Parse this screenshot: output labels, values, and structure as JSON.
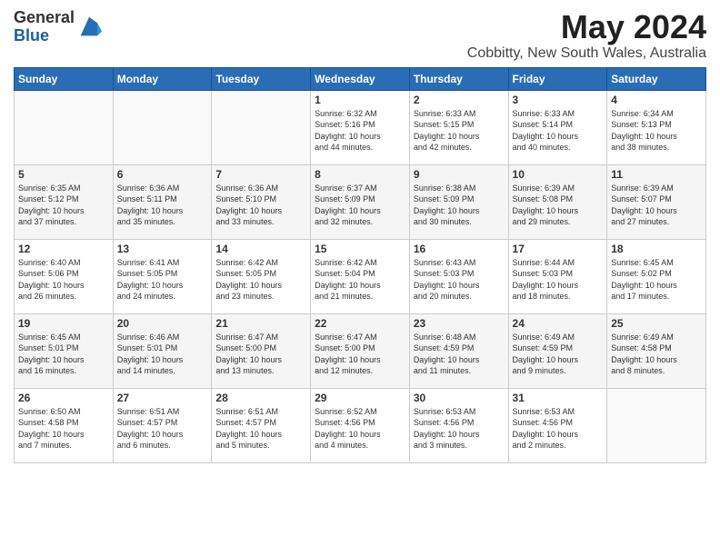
{
  "header": {
    "logo_general": "General",
    "logo_blue": "Blue",
    "month_title": "May 2024",
    "location": "Cobbitty, New South Wales, Australia"
  },
  "days_of_week": [
    "Sunday",
    "Monday",
    "Tuesday",
    "Wednesday",
    "Thursday",
    "Friday",
    "Saturday"
  ],
  "weeks": [
    {
      "days": [
        {
          "num": "",
          "info": ""
        },
        {
          "num": "",
          "info": ""
        },
        {
          "num": "",
          "info": ""
        },
        {
          "num": "1",
          "info": "Sunrise: 6:32 AM\nSunset: 5:16 PM\nDaylight: 10 hours\nand 44 minutes."
        },
        {
          "num": "2",
          "info": "Sunrise: 6:33 AM\nSunset: 5:15 PM\nDaylight: 10 hours\nand 42 minutes."
        },
        {
          "num": "3",
          "info": "Sunrise: 6:33 AM\nSunset: 5:14 PM\nDaylight: 10 hours\nand 40 minutes."
        },
        {
          "num": "4",
          "info": "Sunrise: 6:34 AM\nSunset: 5:13 PM\nDaylight: 10 hours\nand 38 minutes."
        }
      ]
    },
    {
      "days": [
        {
          "num": "5",
          "info": "Sunrise: 6:35 AM\nSunset: 5:12 PM\nDaylight: 10 hours\nand 37 minutes."
        },
        {
          "num": "6",
          "info": "Sunrise: 6:36 AM\nSunset: 5:11 PM\nDaylight: 10 hours\nand 35 minutes."
        },
        {
          "num": "7",
          "info": "Sunrise: 6:36 AM\nSunset: 5:10 PM\nDaylight: 10 hours\nand 33 minutes."
        },
        {
          "num": "8",
          "info": "Sunrise: 6:37 AM\nSunset: 5:09 PM\nDaylight: 10 hours\nand 32 minutes."
        },
        {
          "num": "9",
          "info": "Sunrise: 6:38 AM\nSunset: 5:09 PM\nDaylight: 10 hours\nand 30 minutes."
        },
        {
          "num": "10",
          "info": "Sunrise: 6:39 AM\nSunset: 5:08 PM\nDaylight: 10 hours\nand 29 minutes."
        },
        {
          "num": "11",
          "info": "Sunrise: 6:39 AM\nSunset: 5:07 PM\nDaylight: 10 hours\nand 27 minutes."
        }
      ]
    },
    {
      "days": [
        {
          "num": "12",
          "info": "Sunrise: 6:40 AM\nSunset: 5:06 PM\nDaylight: 10 hours\nand 26 minutes."
        },
        {
          "num": "13",
          "info": "Sunrise: 6:41 AM\nSunset: 5:05 PM\nDaylight: 10 hours\nand 24 minutes."
        },
        {
          "num": "14",
          "info": "Sunrise: 6:42 AM\nSunset: 5:05 PM\nDaylight: 10 hours\nand 23 minutes."
        },
        {
          "num": "15",
          "info": "Sunrise: 6:42 AM\nSunset: 5:04 PM\nDaylight: 10 hours\nand 21 minutes."
        },
        {
          "num": "16",
          "info": "Sunrise: 6:43 AM\nSunset: 5:03 PM\nDaylight: 10 hours\nand 20 minutes."
        },
        {
          "num": "17",
          "info": "Sunrise: 6:44 AM\nSunset: 5:03 PM\nDaylight: 10 hours\nand 18 minutes."
        },
        {
          "num": "18",
          "info": "Sunrise: 6:45 AM\nSunset: 5:02 PM\nDaylight: 10 hours\nand 17 minutes."
        }
      ]
    },
    {
      "days": [
        {
          "num": "19",
          "info": "Sunrise: 6:45 AM\nSunset: 5:01 PM\nDaylight: 10 hours\nand 16 minutes."
        },
        {
          "num": "20",
          "info": "Sunrise: 6:46 AM\nSunset: 5:01 PM\nDaylight: 10 hours\nand 14 minutes."
        },
        {
          "num": "21",
          "info": "Sunrise: 6:47 AM\nSunset: 5:00 PM\nDaylight: 10 hours\nand 13 minutes."
        },
        {
          "num": "22",
          "info": "Sunrise: 6:47 AM\nSunset: 5:00 PM\nDaylight: 10 hours\nand 12 minutes."
        },
        {
          "num": "23",
          "info": "Sunrise: 6:48 AM\nSunset: 4:59 PM\nDaylight: 10 hours\nand 11 minutes."
        },
        {
          "num": "24",
          "info": "Sunrise: 6:49 AM\nSunset: 4:59 PM\nDaylight: 10 hours\nand 9 minutes."
        },
        {
          "num": "25",
          "info": "Sunrise: 6:49 AM\nSunset: 4:58 PM\nDaylight: 10 hours\nand 8 minutes."
        }
      ]
    },
    {
      "days": [
        {
          "num": "26",
          "info": "Sunrise: 6:50 AM\nSunset: 4:58 PM\nDaylight: 10 hours\nand 7 minutes."
        },
        {
          "num": "27",
          "info": "Sunrise: 6:51 AM\nSunset: 4:57 PM\nDaylight: 10 hours\nand 6 minutes."
        },
        {
          "num": "28",
          "info": "Sunrise: 6:51 AM\nSunset: 4:57 PM\nDaylight: 10 hours\nand 5 minutes."
        },
        {
          "num": "29",
          "info": "Sunrise: 6:52 AM\nSunset: 4:56 PM\nDaylight: 10 hours\nand 4 minutes."
        },
        {
          "num": "30",
          "info": "Sunrise: 6:53 AM\nSunset: 4:56 PM\nDaylight: 10 hours\nand 3 minutes."
        },
        {
          "num": "31",
          "info": "Sunrise: 6:53 AM\nSunset: 4:56 PM\nDaylight: 10 hours\nand 2 minutes."
        },
        {
          "num": "",
          "info": ""
        }
      ]
    }
  ]
}
